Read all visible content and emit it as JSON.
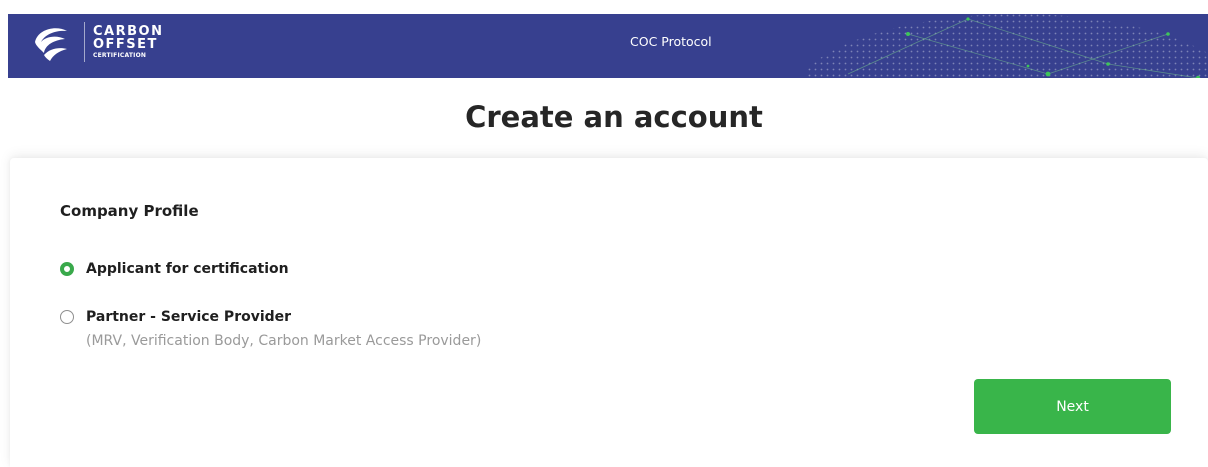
{
  "header": {
    "logo_line1": "CARBON",
    "logo_line2": "OFFSET",
    "logo_line3": "CERTIFICATION",
    "title": "COC Protocol",
    "background_color": "#37408f"
  },
  "page": {
    "title": "Create an account"
  },
  "company_profile": {
    "section_title": "Company Profile",
    "options": [
      {
        "label": "Applicant for certification",
        "sublabel": "",
        "selected": true
      },
      {
        "label": "Partner - Service Provider",
        "sublabel": "(MRV, Verification Body, Carbon Market Access Provider)",
        "selected": false
      }
    ],
    "accent_color": "#39a94b"
  },
  "actions": {
    "next_label": "Next",
    "next_color": "#39b54a"
  },
  "icons": {
    "logo": "leaf-logo-icon",
    "radio_checked": "radio-checked-icon",
    "radio_unchecked": "radio-unchecked-icon",
    "header_decoration": "globe-dots-icon"
  }
}
